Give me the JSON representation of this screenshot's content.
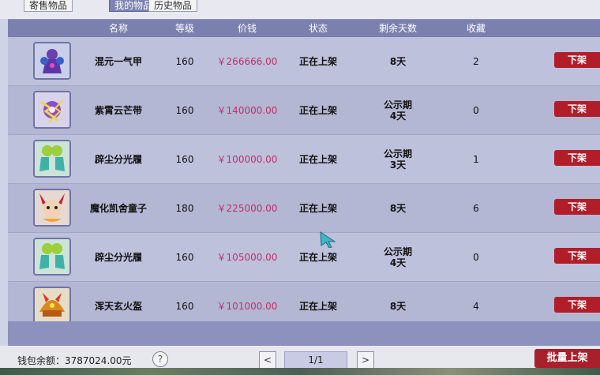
{
  "tabs": [
    {
      "label": "寄售物品",
      "active": false
    },
    {
      "label": "我的物品",
      "active": true
    },
    {
      "label": "历史物品",
      "active": false
    }
  ],
  "columns": [
    "名称",
    "等级",
    "价钱",
    "状态",
    "剩余天数",
    "收藏"
  ],
  "rows": [
    {
      "name": "混元一气甲",
      "level": "160",
      "price": "￥266666.00",
      "status": "正在上架",
      "days1": "8天",
      "days2": "",
      "fav": "2",
      "action": "下架",
      "icon": "purple-armor-icon"
    },
    {
      "name": "紫霄云芒带",
      "level": "160",
      "price": "￥140000.00",
      "status": "正在上架",
      "days1": "公示期",
      "days2": "4天",
      "fav": "0",
      "action": "下架",
      "icon": "lightning-belt-icon"
    },
    {
      "name": "辟尘分光履",
      "level": "160",
      "price": "￥100000.00",
      "status": "正在上架",
      "days1": "公示期",
      "days2": "3天",
      "fav": "1",
      "action": "下架",
      "icon": "green-boots-icon"
    },
    {
      "name": "魔化凯舍童子",
      "level": "180",
      "price": "￥225000.00",
      "status": "正在上架",
      "days1": "8天",
      "days2": "",
      "fav": "6",
      "action": "下架",
      "icon": "demon-child-icon"
    },
    {
      "name": "辟尘分光履",
      "level": "160",
      "price": "￥105000.00",
      "status": "正在上架",
      "days1": "公示期",
      "days2": "4天",
      "fav": "0",
      "action": "下架",
      "icon": "green-boots-icon"
    },
    {
      "name": "浑天玄火盔",
      "level": "160",
      "price": "￥101000.00",
      "status": "正在上架",
      "days1": "8天",
      "days2": "",
      "fav": "4",
      "action": "下架",
      "icon": "fire-helmet-icon"
    }
  ],
  "footer": {
    "wallet_label": "钱包余额：3787024.00元",
    "help": "?",
    "prev": "<",
    "page": "1/1",
    "next": ">",
    "batch_label": "批量上架"
  },
  "colors": {
    "header": "#7b80af",
    "price": "#c0306a",
    "button": "#b21d2a"
  }
}
